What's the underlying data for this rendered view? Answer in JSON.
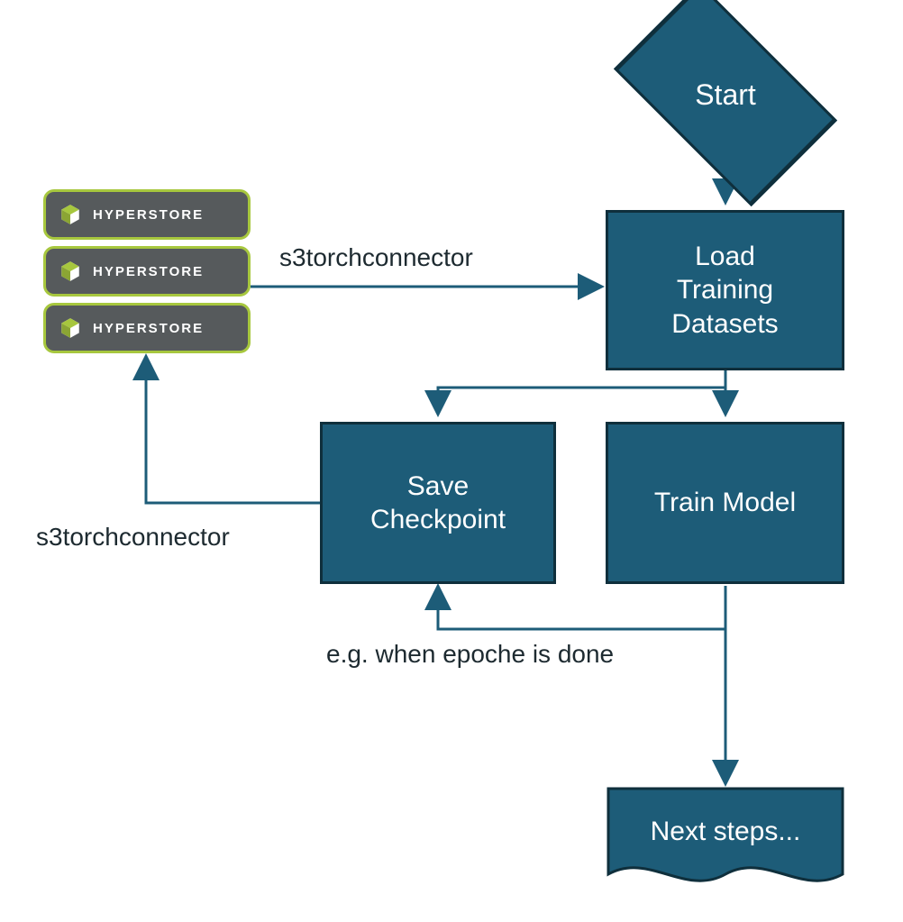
{
  "nodes": {
    "start": "Start",
    "load": "Load\nTraining\nDatasets",
    "train": "Train Model",
    "save": "Save\nCheckpoint",
    "next": "Next steps..."
  },
  "labels": {
    "connector_top": "s3torchconnector",
    "connector_left": "s3torchconnector",
    "epoch_note": "e.g. when epoche is done"
  },
  "hyperstore": {
    "brand": "HYPERSTORE",
    "instances": 3
  },
  "colors": {
    "node_fill": "#1d5c78",
    "node_border": "#0f2f3c",
    "arrow": "#1d5c78",
    "hs_border": "#a7c73e",
    "hs_fill": "#565a5c"
  }
}
